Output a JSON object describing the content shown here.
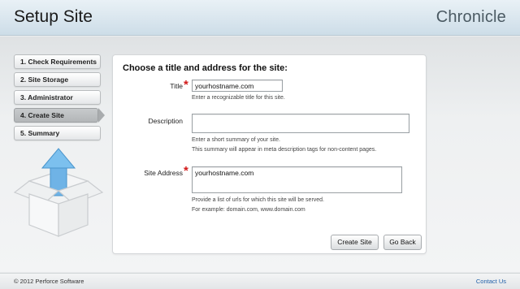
{
  "header": {
    "title": "Setup Site",
    "brand": "Chronicle"
  },
  "steps": [
    {
      "label": "1. Check Requirements",
      "active": false
    },
    {
      "label": "2. Site Storage",
      "active": false
    },
    {
      "label": "3. Administrator",
      "active": false
    },
    {
      "label": "4. Create Site",
      "active": true
    },
    {
      "label": "5. Summary",
      "active": false
    }
  ],
  "form": {
    "heading": "Choose a title and address for the site:",
    "title": {
      "label": "Title",
      "value": "yourhostname.com",
      "hint": "Enter a recognizable title for this site."
    },
    "description": {
      "label": "Description",
      "value": "",
      "hint1": "Enter a short summary of your site.",
      "hint2": "This summary will appear in meta description tags for non-content pages."
    },
    "address": {
      "label": "Site Address",
      "value": "yourhostname.com",
      "hint1": "Provide a list of urls for which this site will be served.",
      "hint2": "For example: domain.com, www.domain.com"
    },
    "required_marker": "*",
    "create_label": "Create Site",
    "back_label": "Go Back"
  },
  "footer": {
    "copyright": "© 2012 Perforce Software",
    "contact": "Contact Us"
  },
  "colors": {
    "accent_link": "#1f5fa8",
    "required": "#d21a1a",
    "arrow": "#6fb3e6"
  },
  "icons": {
    "illustration": "box-with-up-arrow-icon"
  }
}
